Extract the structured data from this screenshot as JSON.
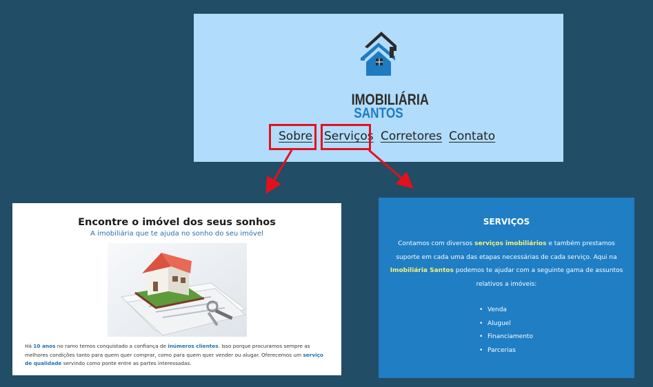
{
  "header": {
    "logo": {
      "line1": "IMOBILIÁRIA",
      "line2": "SANTOS"
    },
    "nav": [
      {
        "label": "Sobre",
        "highlighted": true
      },
      {
        "label": "Serviços",
        "highlighted": true
      },
      {
        "label": "Corretores",
        "highlighted": false
      },
      {
        "label": "Contato",
        "highlighted": false
      }
    ]
  },
  "sobre": {
    "title": "Encontre o imóvel dos seus sonhos",
    "subtitle": "A imobiliária que te ajuda no sonho do seu imóvel",
    "image_icon": "house-with-keys-image",
    "text": {
      "p1": "Há ",
      "b1": "10 anos",
      "p2": " no ramo temos conquistado a confiança de ",
      "b2": "inúmeros clientes",
      "p3": ". Isso porque procuramos sempre as melhores condições tanto para quem quer comprar, como para quem quer vender ou alugar. Oferecemos um ",
      "b3": "serviço de qualidade",
      "p4": " servindo como ponte entre as partes interessadas."
    }
  },
  "servicos": {
    "title": "SERVIÇOS",
    "text": {
      "p1": "Contamos com diversos ",
      "b1": "serviços imobiliários",
      "p2": " e também prestamos suporte em cada uma das etapas necessárias de cada serviço. Aqui na ",
      "b2": "Imobiliária Santos",
      "p3": " podemos te ajudar com a seguinte gama de assuntos relativos a imóveis:"
    },
    "items": [
      "Venda",
      "Aluguel",
      "Financiamento",
      "Parcerias"
    ]
  },
  "colors": {
    "background": "#214d66",
    "header_bg": "#b1dcfb",
    "highlight": "#e3101d",
    "servicos_bg": "#1f7ec4",
    "accent_blue": "#1f6fb0",
    "accent_yellow": "#f5f27a"
  }
}
